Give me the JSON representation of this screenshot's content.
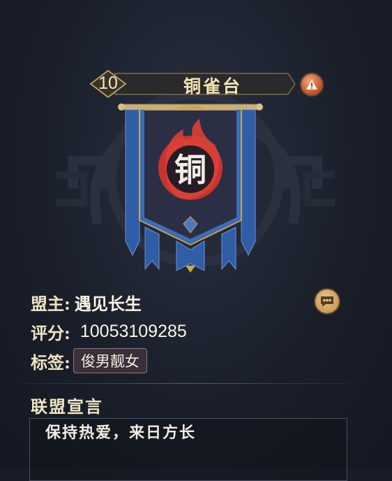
{
  "header": {
    "level": "10",
    "alliance_name": "铜雀台"
  },
  "banner": {
    "emblem_char": "铜",
    "colors": {
      "cloth": "#2a2f45",
      "trim": "#3d6cb8",
      "gold": "#c9a55a",
      "flame": "#d33a32"
    }
  },
  "info": {
    "leader_label": "盟主:",
    "leader_name": "遇见长生",
    "score_label": "评分:",
    "score_value": "10053109285",
    "tags_label": "标签:",
    "tag": "俊男靓女"
  },
  "declaration": {
    "title": "联盟宣言",
    "text": "保持热爱，来日方长"
  },
  "icons": {
    "warning": "warning-icon",
    "chat": "chat-bubble-icon"
  }
}
